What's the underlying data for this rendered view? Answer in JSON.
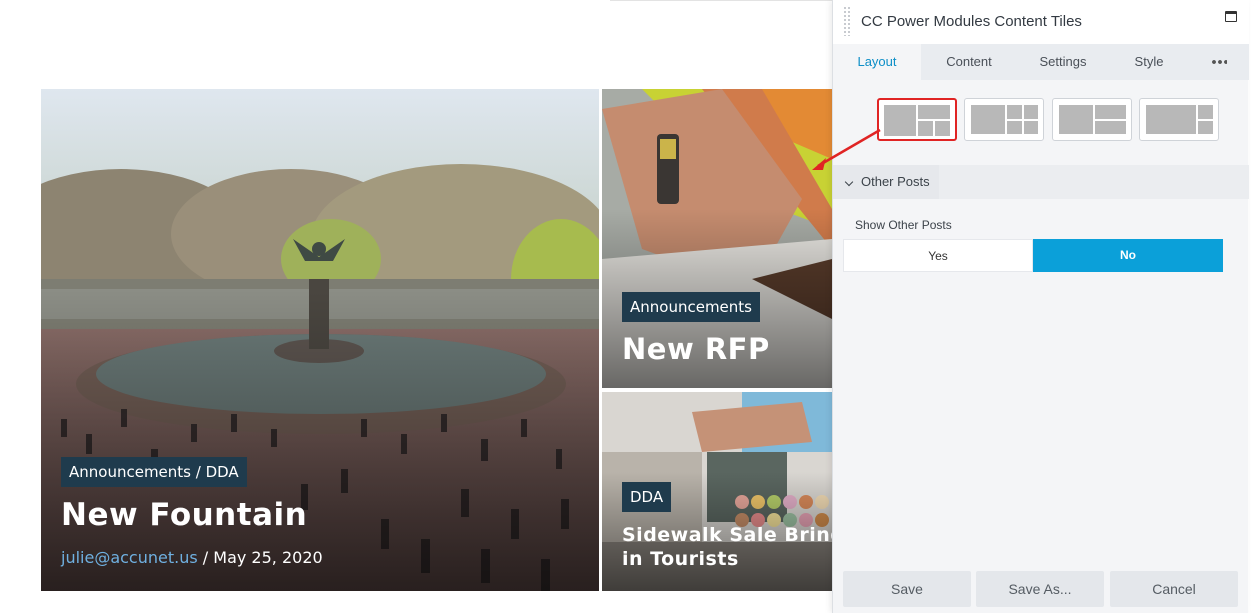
{
  "tiles": [
    {
      "category": "Announcements / DDA",
      "title": "New Fountain",
      "author": "julie@accunet.us",
      "separator": "/",
      "date": "May 25, 2020"
    },
    {
      "category": "Announcements",
      "title": "New RFP"
    },
    {
      "category": "DDA",
      "title_line1": "Sidewalk Sale Brings",
      "title_line2": "in Tourists"
    }
  ],
  "panel": {
    "title": "CC Power Modules Content Tiles",
    "tabs": [
      {
        "label": "Layout",
        "active": true
      },
      {
        "label": "Content",
        "active": false
      },
      {
        "label": "Settings",
        "active": false
      },
      {
        "label": "Style",
        "active": false
      }
    ],
    "layout_options": [
      "layout-1",
      "layout-2",
      "layout-3",
      "layout-4"
    ],
    "selected_layout": 0,
    "section": {
      "title": "Other Posts",
      "field_label": "Show Other Posts",
      "options": [
        "Yes",
        "No"
      ],
      "selected": "No"
    },
    "buttons": {
      "save": "Save",
      "save_as": "Save As...",
      "cancel": "Cancel"
    }
  },
  "colors": {
    "accent": "#0ba0d9",
    "active_tab": "#0d8fc7",
    "badge_bg": "#1f3b4d",
    "highlight_red": "#e02424",
    "author_link": "#6fb0e0"
  },
  "icons": [
    "drag-handle-icon",
    "maximize-icon",
    "more-dots-icon",
    "chevron-down-icon"
  ]
}
